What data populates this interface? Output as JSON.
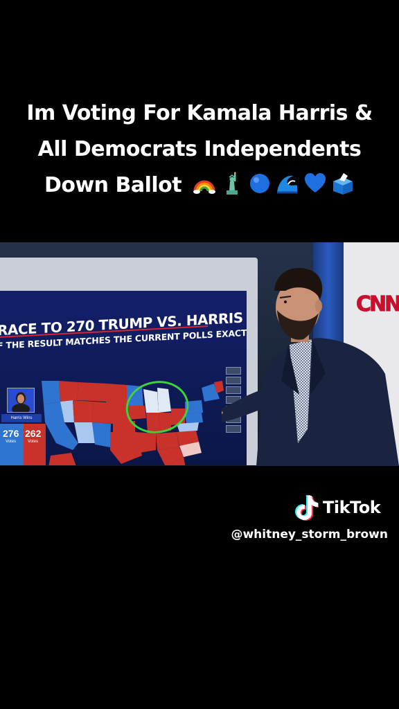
{
  "caption": {
    "line1": "Im Voting For Kamala Harris &",
    "line2": "All Democrats Independents",
    "line3": "Down Ballot",
    "emojis": [
      "rainbow-icon",
      "statue-of-liberty-icon",
      "blue-circle-icon",
      "wave-icon",
      "blue-heart-icon",
      "ballot-box-icon"
    ]
  },
  "video": {
    "graphic_title": "RACE TO 270 TRUMP VS. HARRIS",
    "graphic_subtitle": "F THE RESULT MATCHES THE CURRENT POLLS EXACTLY",
    "winner_label": "Harris Wins",
    "harris_votes": "276",
    "trump_votes": "262",
    "votes_label": "Votes",
    "network_logo": "CNN",
    "colors": {
      "dem": "#2f74d0",
      "rep": "#c8322a",
      "highlight": "#3fd13a"
    }
  },
  "tiktok": {
    "brand": "TikTok",
    "username": "@whitney_storm_brown"
  }
}
